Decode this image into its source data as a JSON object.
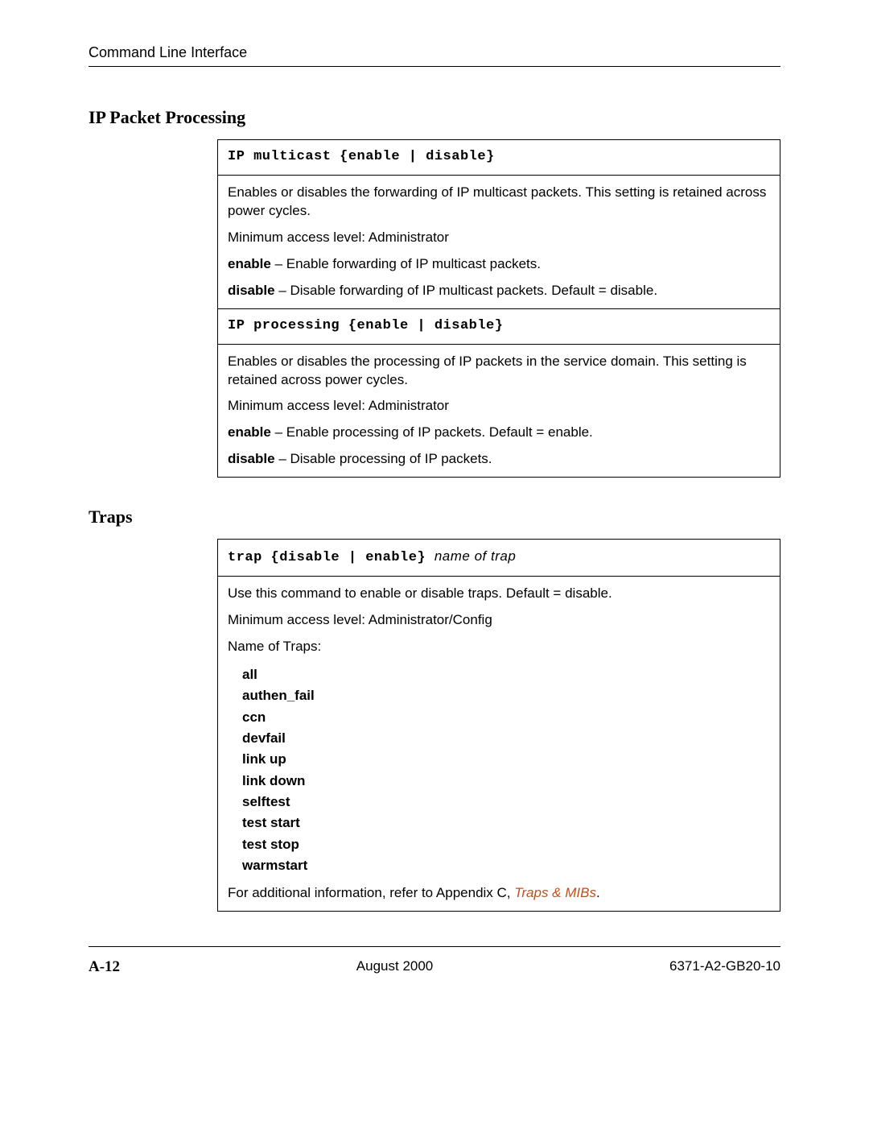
{
  "header": {
    "running_head": "Command Line Interface"
  },
  "sections": {
    "ip": {
      "heading": "IP Packet Processing",
      "multicast": {
        "syntax": "IP multicast {enable | disable}",
        "desc": "Enables or disables the forwarding of IP multicast packets. This setting is retained across power cycles.",
        "access": "Minimum access level:  Administrator",
        "enable_label": "enable",
        "enable_desc": " – Enable forwarding of IP multicast packets.",
        "disable_label": "disable",
        "disable_desc": " – Disable forwarding of IP multicast packets. Default = disable."
      },
      "processing": {
        "syntax": "IP processing {enable | disable}",
        "desc": "Enables or disables the processing of IP packets in the service domain. This setting is retained across power cycles.",
        "access": "Minimum access level:  Administrator",
        "enable_label": "enable",
        "enable_desc": " – Enable processing of IP packets. Default = enable.",
        "disable_label": "disable",
        "disable_desc": " – Disable processing of IP packets."
      }
    },
    "traps": {
      "heading": "Traps",
      "trap": {
        "syntax": "trap {disable | enable}  ",
        "syntax_arg": "name of trap",
        "desc": "Use this command to enable or disable traps. Default = disable.",
        "access": "Minimum access level:  Administrator/Config",
        "list_label": "Name of Traps:",
        "items": {
          "0": "all",
          "1": "authen_fail",
          "2": "ccn",
          "3": "devfail",
          "4": "link up",
          "5": "link down",
          "6": "selftest",
          "7": "test start",
          "8": "test stop",
          "9": "warmstart"
        },
        "footnote_prefix": "For additional information, refer to Appendix C, ",
        "footnote_link": "Traps & MIBs",
        "footnote_suffix": "."
      }
    }
  },
  "footer": {
    "page": "A-12",
    "date": "August 2000",
    "docnum": "6371-A2-GB20-10"
  }
}
